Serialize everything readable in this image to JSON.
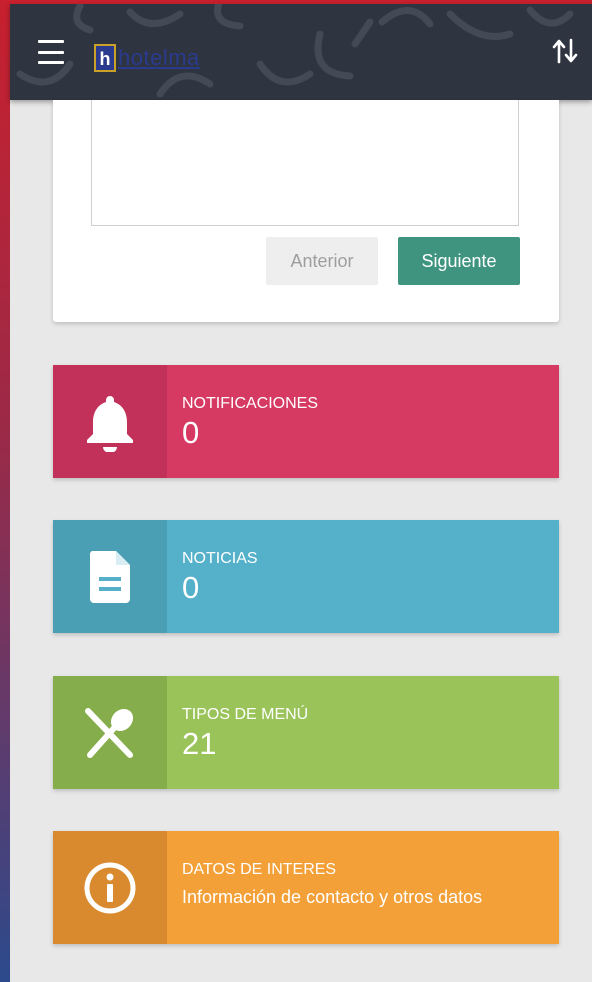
{
  "app_bar": {
    "logo_mark": "h",
    "logo_text": "hotelma",
    "menu_icon": "hamburger-icon",
    "sort_icon": "sort-arrows-icon"
  },
  "form": {
    "prev_label": "Anterior",
    "next_label": "Siguiente"
  },
  "tiles": [
    {
      "title": "NOTIFICACIONES",
      "value": "0",
      "icon": "bell-icon",
      "color": "#d63a63",
      "icon_bg": "#c2315a"
    },
    {
      "title": "NOTICIAS",
      "value": "0",
      "icon": "document-icon",
      "color": "#54b1c9",
      "icon_bg": "#4a9fb5"
    },
    {
      "title": "TIPOS DE MENÚ",
      "value": "21",
      "icon": "fork-spoon-icon",
      "color": "#9ac35a",
      "icon_bg": "#86ad4b"
    },
    {
      "title": "DATOS DE INTERES",
      "value": "Información de contacto y otros datos",
      "icon": "info-icon",
      "color": "#f2a037",
      "icon_bg": "#d98a2e"
    }
  ],
  "colors": {
    "app_bar": "#2e3440",
    "accent_next": "#3f9480",
    "page_bg": "#e8e8e8"
  }
}
